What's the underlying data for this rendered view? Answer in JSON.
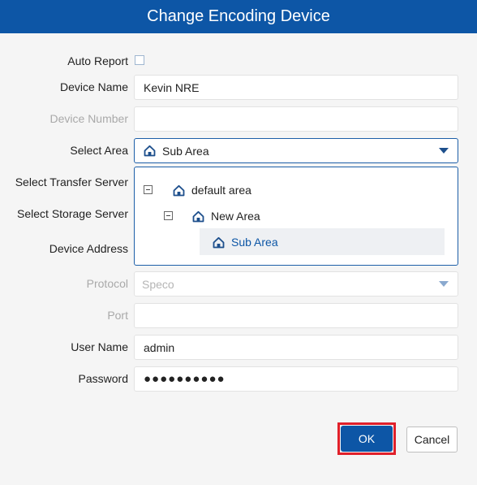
{
  "dialog": {
    "title": "Change Encoding Device"
  },
  "form": {
    "auto_report_label": "Auto Report",
    "auto_report_checked": false,
    "device_name_label": "Device Name",
    "device_name_value": "Kevin NRE",
    "device_number_label": "Device Number",
    "device_number_value": "",
    "select_area_label": "Select Area",
    "select_area_value": "Sub Area",
    "select_transfer_server_label": "Select Transfer Server",
    "select_storage_server_label": "Select Storage Server",
    "device_address_label": "Device Address",
    "protocol_label": "Protocol",
    "protocol_value": "Speco",
    "port_label": "Port",
    "port_value": "",
    "user_name_label": "User Name",
    "user_name_value": "admin",
    "password_label": "Password",
    "password_value": "●●●●●●●●●●"
  },
  "area_tree": {
    "items": [
      {
        "label": "default area",
        "expanded": true,
        "icon": "home-icon"
      },
      {
        "label": "New Area",
        "expanded": true,
        "icon": "home-icon"
      },
      {
        "label": "Sub Area",
        "selected": true,
        "icon": "home-icon"
      }
    ]
  },
  "buttons": {
    "ok": "OK",
    "cancel": "Cancel"
  },
  "colors": {
    "header": "#0d56a6",
    "highlight": "#e0202a",
    "selected_text": "#0d56a6"
  }
}
